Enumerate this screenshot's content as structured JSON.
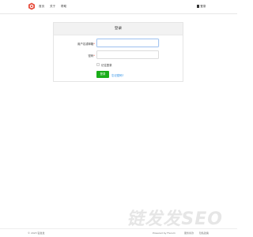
{
  "nav": {
    "logo_icon": "red-hexagon-logo",
    "links": [
      "首页",
      "关于",
      "帮助"
    ],
    "login": "登录"
  },
  "card": {
    "title": "登录",
    "username_label": "用户名或邮箱",
    "password_label": "密码",
    "required_mark": "*",
    "remember": "记住登录",
    "submit": "登录",
    "forgot": "忘记密码?"
  },
  "watermark": "链发发SEO",
  "footer": {
    "copyright": "© 2023 链发发",
    "powered": "Powered by Flarum",
    "link1": "服务条款",
    "link2": "隐私政策"
  },
  "colors": {
    "primary_button": "#1aad19",
    "link": "#1e88e5",
    "required": "#e74c3c",
    "logo": "#e74c3c"
  }
}
